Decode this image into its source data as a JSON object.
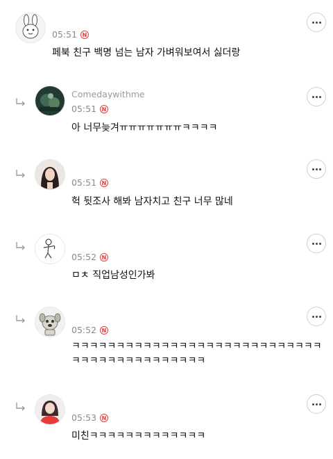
{
  "comments": [
    {
      "user": "",
      "time": "05:51",
      "badge": "N",
      "text": "페북 친구 백명 넘는 남자 가벼워보여서 싫더랑",
      "is_reply": false
    },
    {
      "user": "Comedaywithme",
      "time": "05:51",
      "badge": "N",
      "text": "아 너무늦겨ㅠㅠㅠㅠㅠㅠㅠㅋㅋㅋㅋ",
      "is_reply": true
    },
    {
      "user": "",
      "time": "05:51",
      "badge": "N",
      "text": "헉 뒷조사 해봐 남자치고 친구 너무 많네",
      "is_reply": true
    },
    {
      "user": "",
      "time": "05:52",
      "badge": "N",
      "text": "ㅁㅊ 직업남성인가봐",
      "is_reply": true
    },
    {
      "user": "",
      "time": "05:52",
      "badge": "N",
      "text": "ㅋㅋㅋㅋㅋㅋㅋㅋㅋㅋㅋㅋㅋㅋㅋㅋㅋㅋㅋㅋㅋㅋㅋㅋㅋㅋㅋㅋㅋㅋㅋㅋㅋㅋㅋㅋㅋㅋㅋㅋㅋㅋㅋ",
      "is_reply": true
    },
    {
      "user": "",
      "time": "05:53",
      "badge": "N",
      "text": "미친ㅋㅋㅋㅋㅋㅋㅋㅋㅋㅋㅋㅋㅋ",
      "is_reply": true
    }
  ],
  "icons": {
    "more": "more-options-icon",
    "reply": "reply-arrow-icon",
    "badge": "new-badge-icon"
  },
  "colors": {
    "badge": "#e83a3a",
    "meta": "#8a8a8a",
    "divider": "#e4e4e4"
  }
}
